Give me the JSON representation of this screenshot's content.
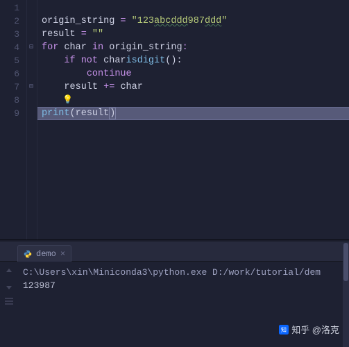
{
  "gutter": {
    "lines": [
      "1",
      "2",
      "3",
      "4",
      "5",
      "6",
      "7",
      "8",
      "9"
    ]
  },
  "code": {
    "l2": {
      "var": "origin_string ",
      "op": "= ",
      "q1": "\"",
      "s1": "123",
      "s2": "abcddd",
      "s3": "987",
      "s4": "ddd",
      "q2": "\""
    },
    "l3": {
      "var": "result ",
      "op": "= ",
      "str": "\"\""
    },
    "l4": {
      "kfor": "for ",
      "v1": "char ",
      "kin": "in ",
      "v2": "origin_string",
      ":": ":"
    },
    "l5": {
      "kif": "if not ",
      "v": "char",
      ".": ".",
      "fn": "isdigit",
      "()": "():"
    },
    "l6": {
      "kw": "continue"
    },
    "l7": {
      "v": "result ",
      "op": "+= ",
      "v2": "char"
    },
    "l9": {
      "fn": "print",
      "p1": "(",
      "v": "result",
      "p2": ")"
    }
  },
  "tab": {
    "label": "demo",
    "close": "×"
  },
  "console": {
    "cmd": "C:\\Users\\xin\\Miniconda3\\python.exe D:/work/tutorial/dem",
    "out": "123987"
  },
  "wm": {
    "text": "知乎 @洛克"
  }
}
